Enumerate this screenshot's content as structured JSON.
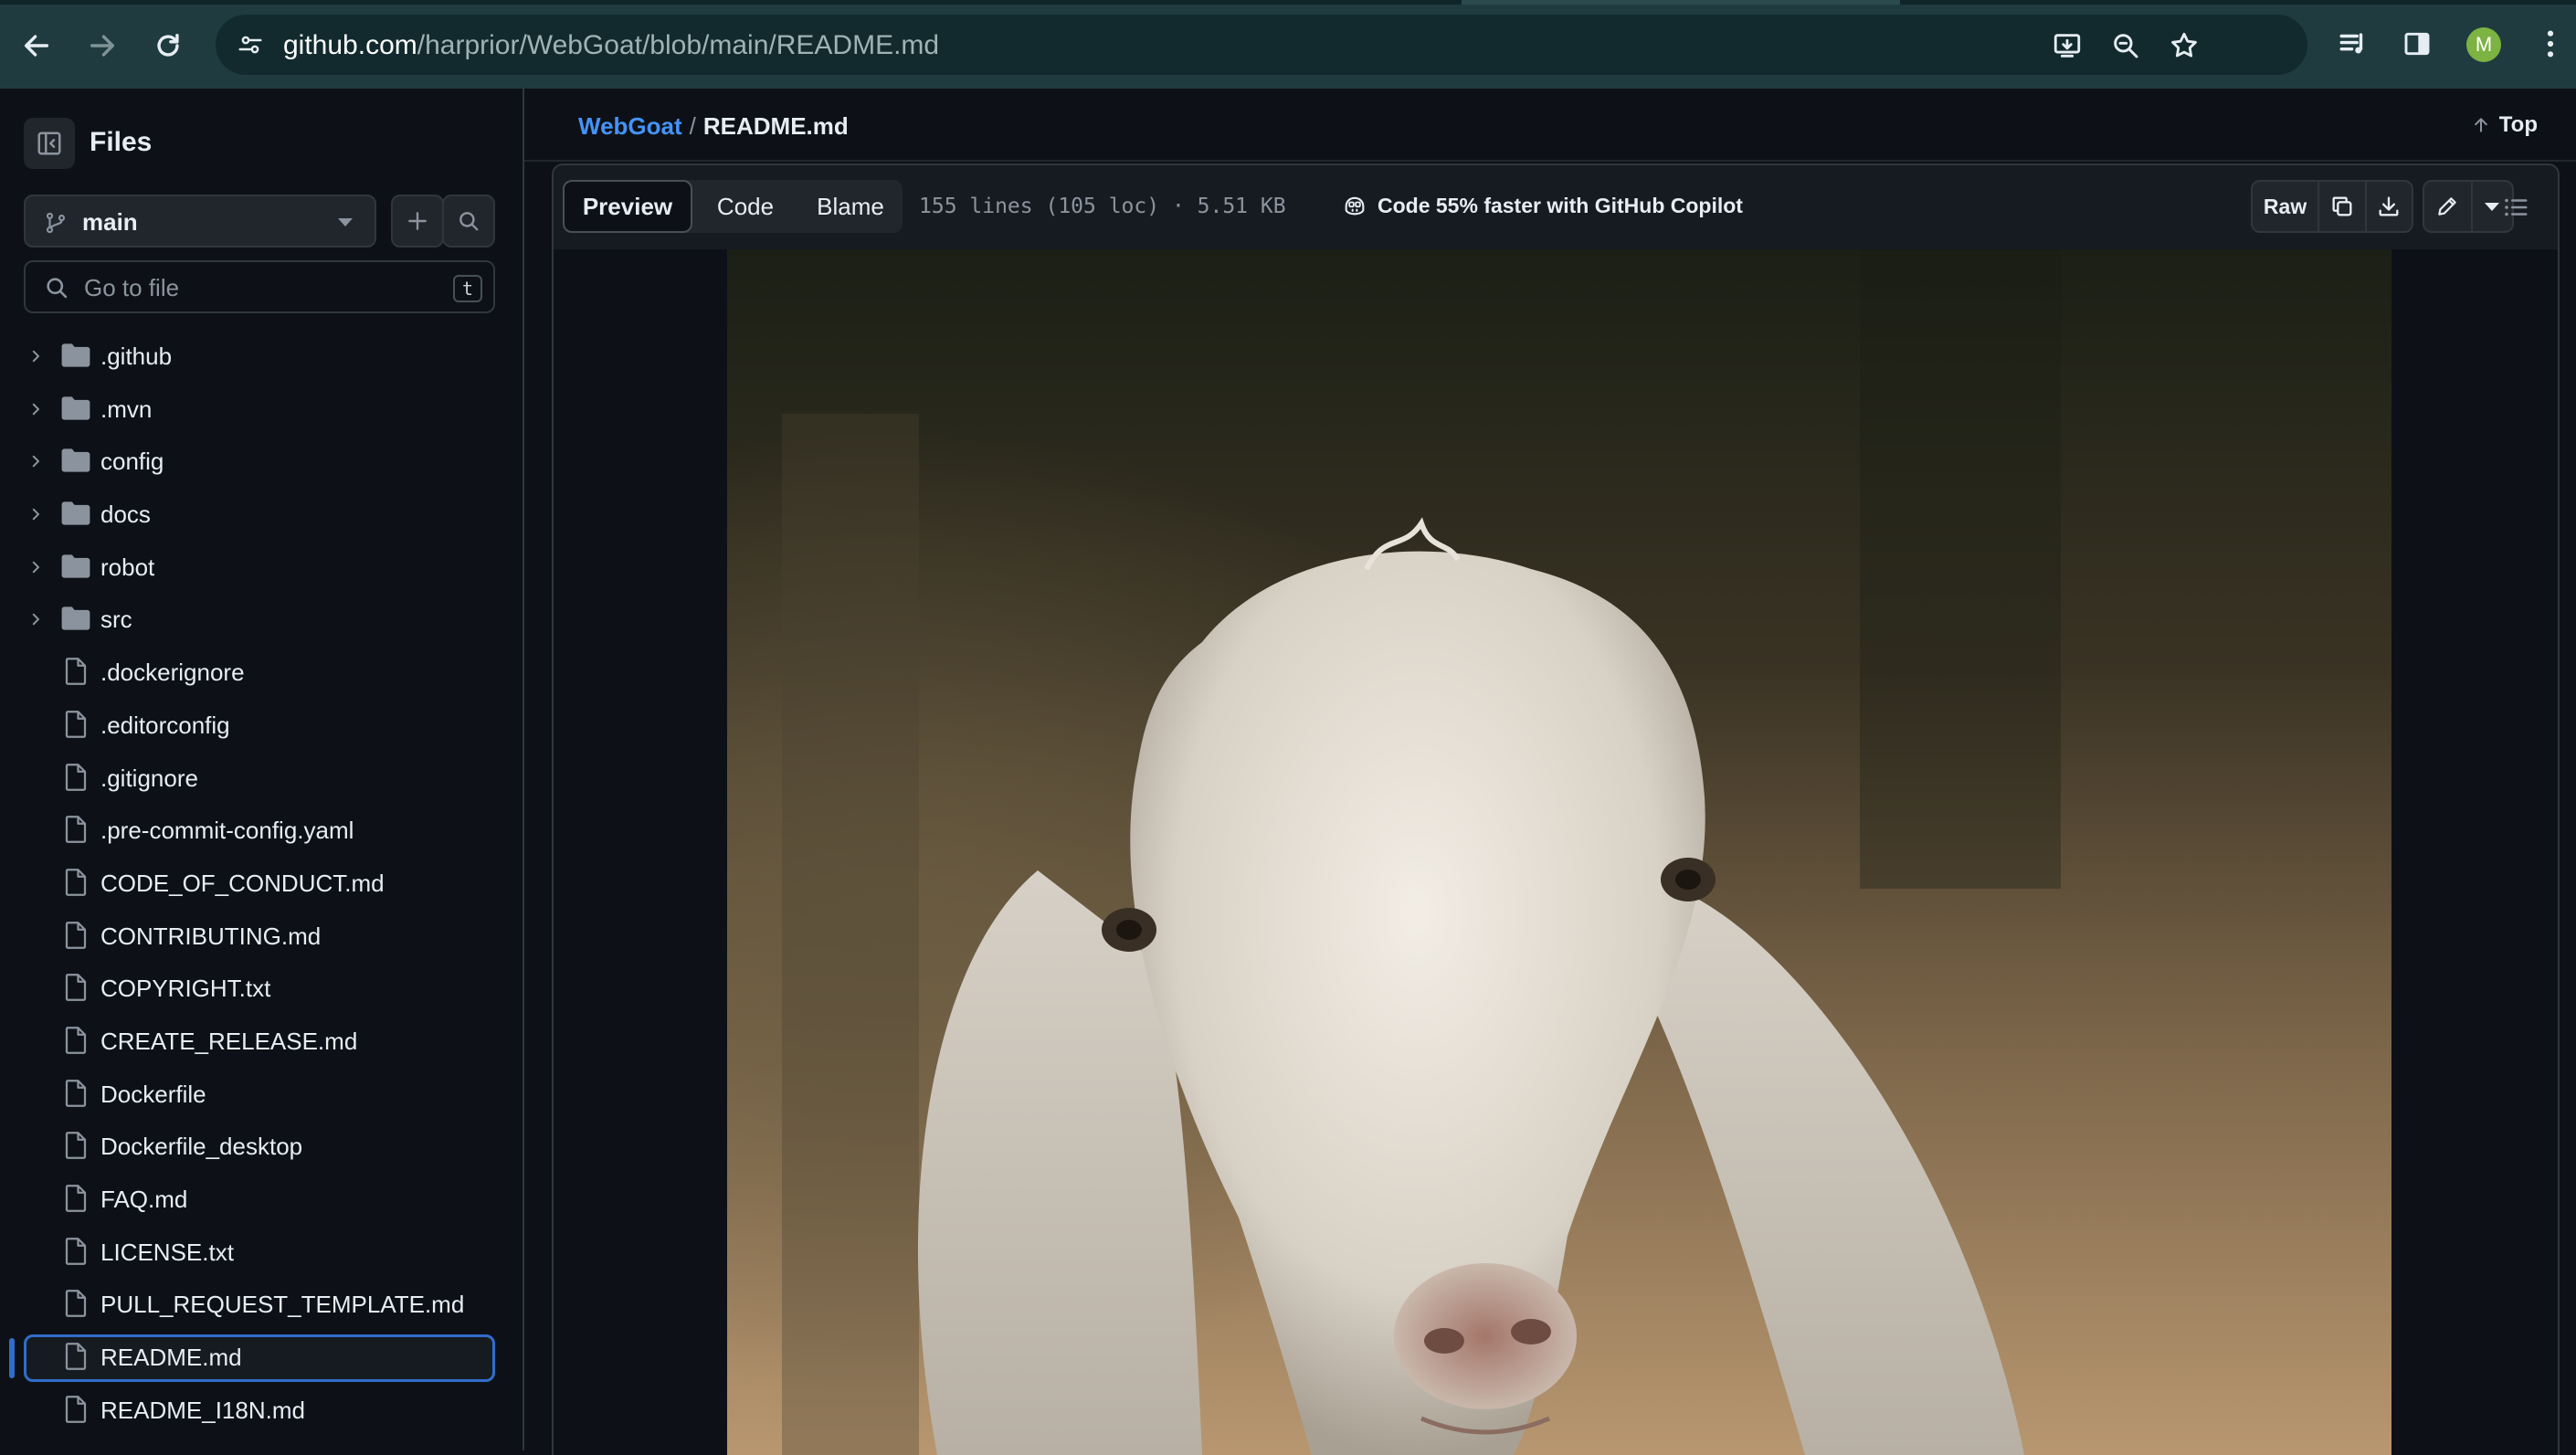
{
  "browser": {
    "url_host": "github.com",
    "url_path": "/harprior/WebGoat/blob/main/README.md",
    "avatar_letter": "M",
    "accent_color": "#1f3b3f"
  },
  "sidebar": {
    "title": "Files",
    "branch": "main",
    "goto_placeholder": "Go to file",
    "goto_shortcut": "t",
    "items": [
      {
        "label": ".github",
        "type": "folder"
      },
      {
        "label": ".mvn",
        "type": "folder"
      },
      {
        "label": "config",
        "type": "folder"
      },
      {
        "label": "docs",
        "type": "folder"
      },
      {
        "label": "robot",
        "type": "folder"
      },
      {
        "label": "src",
        "type": "folder"
      },
      {
        "label": ".dockerignore",
        "type": "file"
      },
      {
        "label": ".editorconfig",
        "type": "file"
      },
      {
        "label": ".gitignore",
        "type": "file"
      },
      {
        "label": ".pre-commit-config.yaml",
        "type": "file"
      },
      {
        "label": "CODE_OF_CONDUCT.md",
        "type": "file"
      },
      {
        "label": "CONTRIBUTING.md",
        "type": "file"
      },
      {
        "label": "COPYRIGHT.txt",
        "type": "file"
      },
      {
        "label": "CREATE_RELEASE.md",
        "type": "file"
      },
      {
        "label": "Dockerfile",
        "type": "file"
      },
      {
        "label": "Dockerfile_desktop",
        "type": "file"
      },
      {
        "label": "FAQ.md",
        "type": "file"
      },
      {
        "label": "LICENSE.txt",
        "type": "file"
      },
      {
        "label": "PULL_REQUEST_TEMPLATE.md",
        "type": "file"
      },
      {
        "label": "README.md",
        "type": "file",
        "selected": true
      },
      {
        "label": "README_I18N.md",
        "type": "file"
      }
    ]
  },
  "main": {
    "breadcrumb_repo": "WebGoat",
    "breadcrumb_sep": "/",
    "breadcrumb_file": "README.md",
    "top_link": "Top",
    "tabs": [
      {
        "label": "Preview",
        "active": true
      },
      {
        "label": "Code",
        "active": false
      },
      {
        "label": "Blame",
        "active": false
      }
    ],
    "file_meta": "155 lines (105 loc) · 5.51 KB",
    "copilot_promo": "Code 55% faster with GitHub Copilot",
    "raw_label": "Raw",
    "link_color": "#4493f8",
    "selection_color": "#316dca"
  }
}
